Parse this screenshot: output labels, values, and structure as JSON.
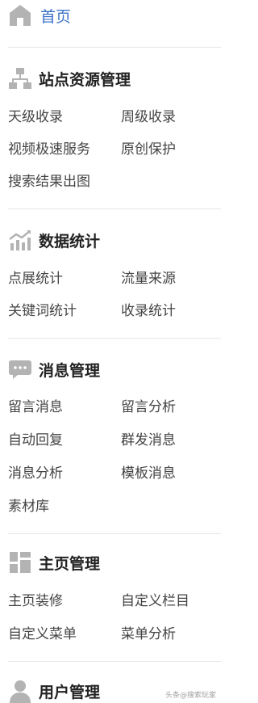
{
  "home": {
    "label": "首页"
  },
  "sections": [
    {
      "title": "站点资源管理",
      "icon": "site-tree-icon",
      "items": [
        "天级收录",
        "周级收录",
        "视频极速服务",
        "原创保护",
        "搜索结果出图"
      ]
    },
    {
      "title": "数据统计",
      "icon": "statistics-chart-icon",
      "items": [
        "点展统计",
        "流量来源",
        "关键词统计",
        "收录统计"
      ]
    },
    {
      "title": "消息管理",
      "icon": "message-bubble-icon",
      "items": [
        "留言消息",
        "留言分析",
        "自动回复",
        "群发消息",
        "消息分析",
        "模板消息",
        "素材库"
      ]
    },
    {
      "title": "主页管理",
      "icon": "homepage-layout-icon",
      "items": [
        "主页装修",
        "自定义栏目",
        "自定义菜单",
        "菜单分析"
      ]
    },
    {
      "title": "用户管理",
      "icon": "user-icon",
      "items": []
    }
  ],
  "watermark": "头条@搜索玩家",
  "colors": {
    "accent": "#3b73c9",
    "icon_gray": "#b3b3b3",
    "divider": "#e6e6e6"
  }
}
